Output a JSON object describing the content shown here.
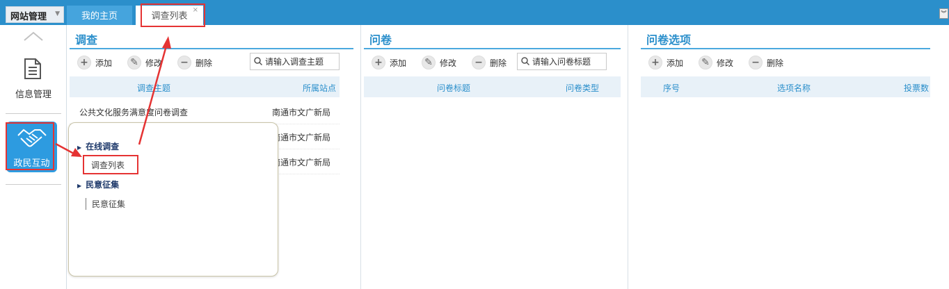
{
  "header": {
    "site_menu": "网站管理",
    "tabs": [
      {
        "label": "我的主页"
      },
      {
        "label": "调查列表"
      }
    ]
  },
  "sidebar": {
    "items": [
      {
        "label": "信息管理",
        "icon": "document-icon"
      },
      {
        "label": "政民互动",
        "icon": "handshake-icon"
      }
    ]
  },
  "panels": {
    "survey": {
      "title": "调查",
      "toolbar": {
        "add": "添加",
        "edit": "修改",
        "delete": "删除"
      },
      "search_placeholder": "请输入调查主题",
      "columns": [
        "调查主题",
        "所属站点"
      ],
      "rows": [
        {
          "topic": "公共文化服务满意度问卷调查",
          "site": "南通市文广新局"
        },
        {
          "topic": "",
          "site": "南通市文广新局"
        },
        {
          "topic": "",
          "site": "南通市文广新局"
        }
      ]
    },
    "questionnaire": {
      "title": "问卷",
      "toolbar": {
        "add": "添加",
        "edit": "修改",
        "delete": "删除"
      },
      "search_placeholder": "请输入问卷标题",
      "columns": [
        "问卷标题",
        "问卷类型"
      ]
    },
    "options": {
      "title": "问卷选项",
      "toolbar": {
        "add": "添加",
        "edit": "修改",
        "delete": "删除"
      },
      "columns": [
        "序号",
        "选项名称",
        "投票数"
      ]
    }
  },
  "popup_menu": {
    "groups": [
      {
        "label": "在线调查",
        "items": [
          "调查列表"
        ]
      },
      {
        "label": "民意征集",
        "items": [
          "民意征集"
        ]
      }
    ]
  },
  "colors": {
    "topbar": "#2b8fcb",
    "accent": "#2d9be0",
    "annotation": "#e53333"
  }
}
